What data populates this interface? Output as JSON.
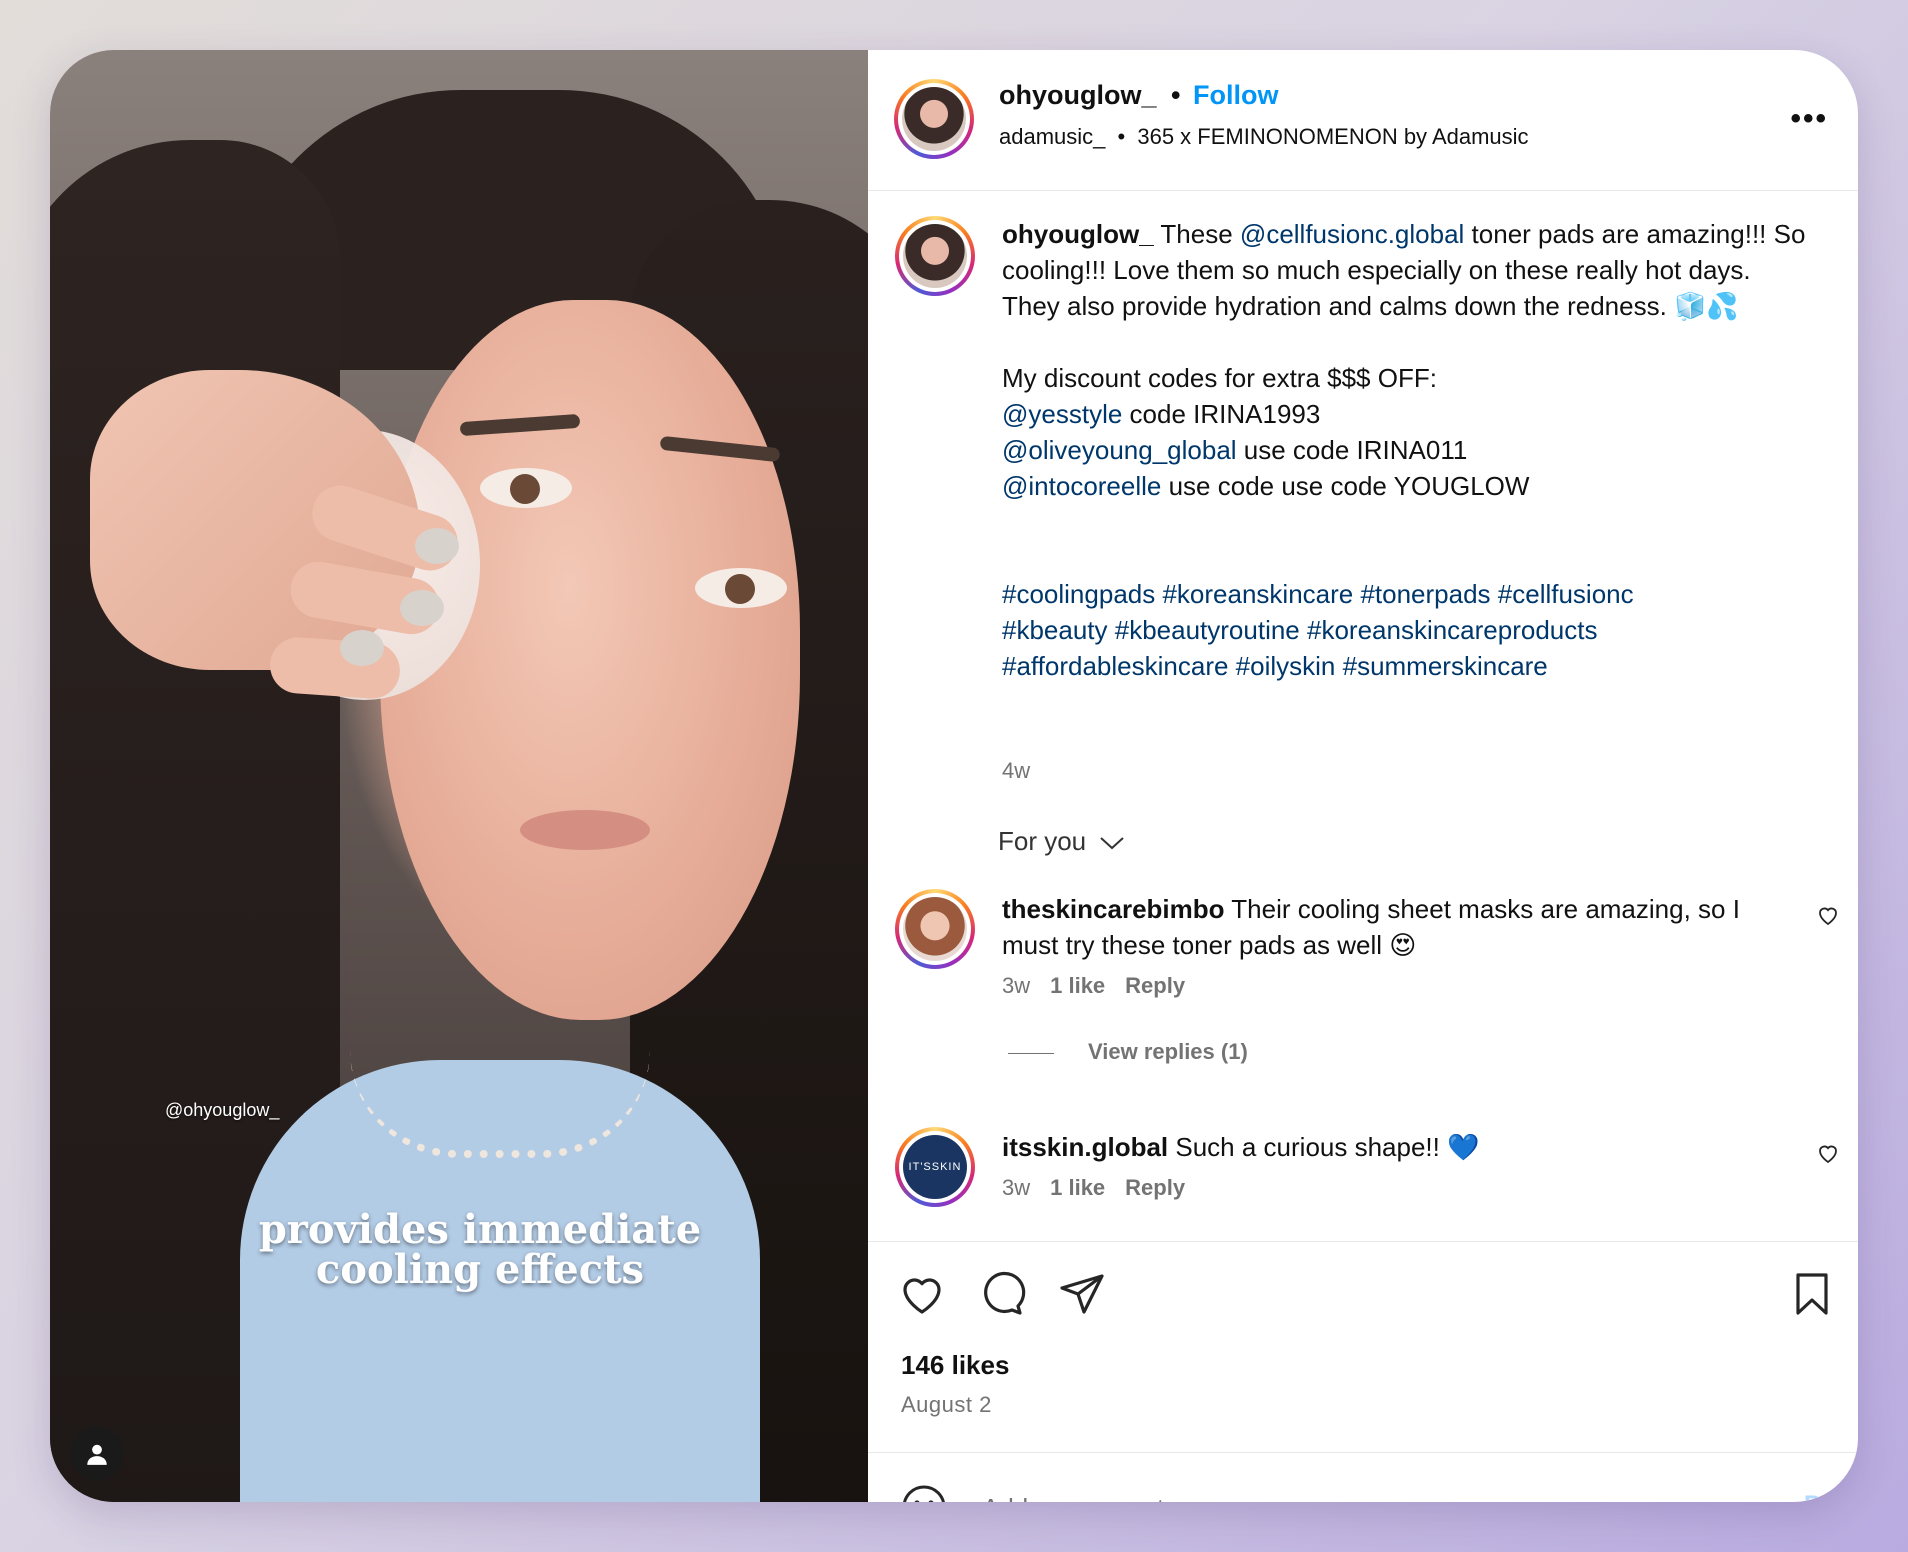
{
  "media": {
    "watermark": "@ohyouglow_",
    "caption_line1": "provides immediate",
    "caption_line2": "cooling effects",
    "user_icon": "user-silhouette-icon"
  },
  "header": {
    "username": "ohyouglow_",
    "separator": "•",
    "follow_label": "Follow",
    "audio_author": "adamusic_",
    "audio_separator": "•",
    "audio_title": "365 x FEMINONOMENON by Adamusic",
    "more_icon": "more-options-icon"
  },
  "post": {
    "username": "ohyouglow_",
    "caption_1": " These ",
    "mention_1": "@cellfusionc.global",
    "caption_2": " toner pads are amazing!!! So cooling!!! Love them so much especially on these really hot days. They also provide hydration and calms down the redness. 🧊💦",
    "discount_heading": "My discount codes for extra $$$ OFF:",
    "code_1_mention": "@yesstyle",
    "code_1_text": " code IRINA1993",
    "code_2_mention": "@oliveyoung_global",
    "code_2_text": " use code IRINA011",
    "code_3_mention": "@intocoreelle",
    "code_3_text": " use code use code YOUGLOW",
    "hashtags_line1": "#coolingpads #koreanskincare #tonerpads #cellfusionc",
    "hashtags_line2": "#kbeauty #kbeautyroutine #koreanskincareproducts",
    "hashtags_line3": "#affordableskincare #oilyskin #summerskincare",
    "age": "4w"
  },
  "sort": {
    "label": "For you"
  },
  "comments": [
    {
      "username": "theskincarebimbo",
      "text": " Their cooling sheet masks are amazing, so I must try these toner pads as well 😍",
      "age": "3w",
      "likes": "1 like",
      "reply": "Reply",
      "view_replies": "View replies (1)"
    },
    {
      "username": "itsskin.global",
      "avatar_text": "IT'SSKIN",
      "text": " Such a curious shape!! 💙",
      "age": "3w",
      "likes": "1 like",
      "reply": "Reply"
    }
  ],
  "actions": {
    "likes": "146 likes",
    "date": "August 2"
  },
  "composer": {
    "placeholder": "Add a comment...",
    "post_label": "Post"
  },
  "colors": {
    "accent": "#0095f6",
    "link": "#00376b",
    "muted": "#737373",
    "post_disabled": "#b3dbff"
  }
}
